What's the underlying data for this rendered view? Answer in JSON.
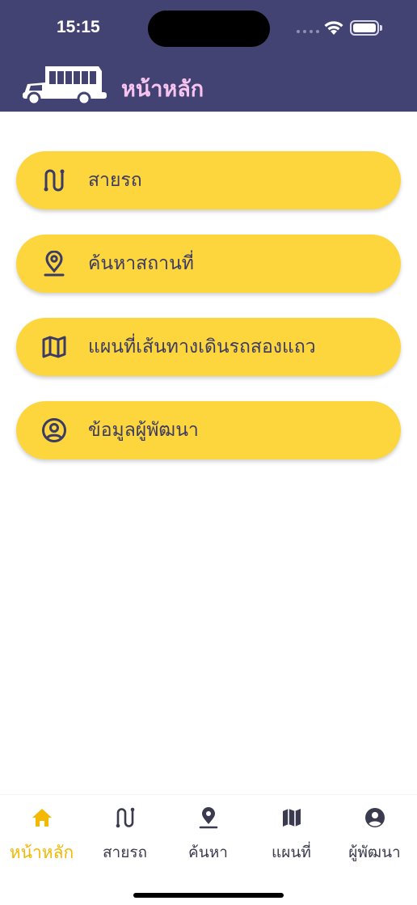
{
  "status": {
    "time": "15:15"
  },
  "header": {
    "title": "หน้าหลัก",
    "logo": "songthaew-truck-icon"
  },
  "menu": {
    "items": [
      {
        "label": "สายรถ",
        "icon": "route-icon"
      },
      {
        "label": "ค้นหาสถานที่",
        "icon": "location-pin-icon"
      },
      {
        "label": "แผนที่เส้นทางเดินรถสองแถว",
        "icon": "map-icon"
      },
      {
        "label": "ข้อมูลผู้พัฒนา",
        "icon": "user-circle-icon"
      }
    ]
  },
  "tabbar": {
    "items": [
      {
        "label": "หน้าหลัก",
        "icon": "home-icon",
        "active": true
      },
      {
        "label": "สายรถ",
        "icon": "route-icon"
      },
      {
        "label": "ค้นหา",
        "icon": "location-pin-icon"
      },
      {
        "label": "แผนที่",
        "icon": "map-icon"
      },
      {
        "label": "ผู้พัฒนา",
        "icon": "user-circle-icon"
      }
    ]
  },
  "colors": {
    "header_bg": "#434373",
    "title": "#f7c4f0",
    "button_bg": "#fdd63d",
    "button_text": "#3b3b63",
    "tab_active": "#f5b800"
  }
}
